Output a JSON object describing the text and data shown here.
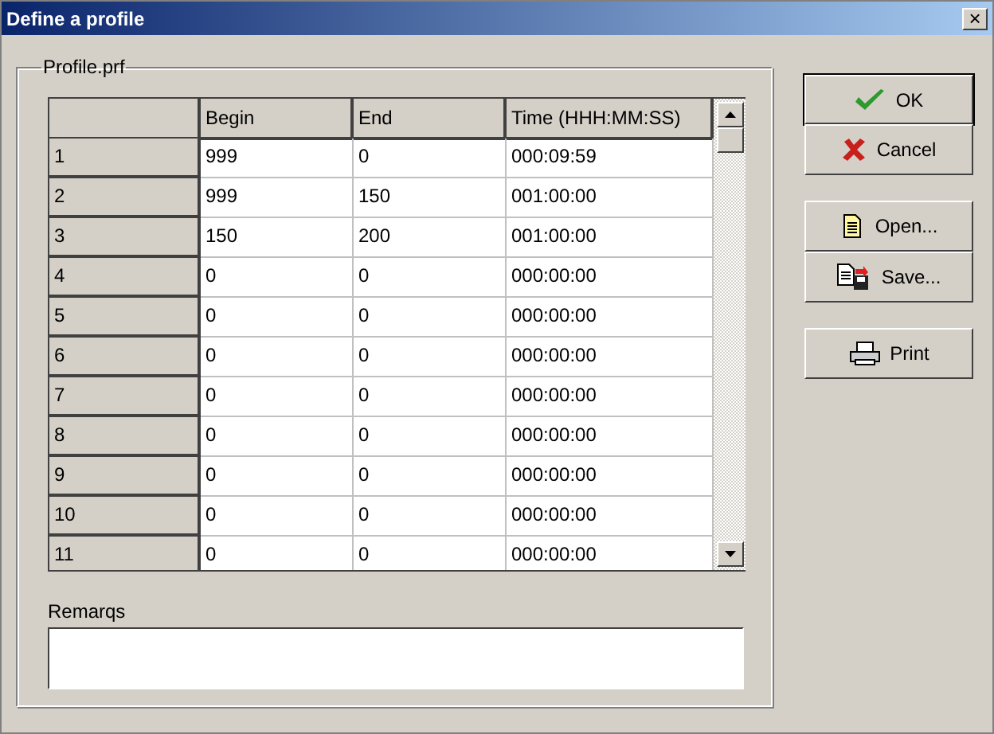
{
  "window": {
    "title": "Define a profile",
    "close": "×"
  },
  "group": {
    "title": "Profile.prf"
  },
  "table": {
    "columns": [
      "Begin",
      "End",
      "Time (HHH:MM:SS)"
    ],
    "rows": [
      {
        "label": "1",
        "cells": [
          "999",
          "0",
          "000:09:59"
        ]
      },
      {
        "label": "2",
        "cells": [
          "999",
          "150",
          "001:00:00"
        ]
      },
      {
        "label": "3",
        "cells": [
          "150",
          "200",
          "001:00:00"
        ]
      },
      {
        "label": "4",
        "cells": [
          "0",
          "0",
          "000:00:00"
        ]
      },
      {
        "label": "5",
        "cells": [
          "0",
          "0",
          "000:00:00"
        ]
      },
      {
        "label": "6",
        "cells": [
          "0",
          "0",
          "000:00:00"
        ]
      },
      {
        "label": "7",
        "cells": [
          "0",
          "0",
          "000:00:00"
        ]
      },
      {
        "label": "8",
        "cells": [
          "0",
          "0",
          "000:00:00"
        ]
      },
      {
        "label": "9",
        "cells": [
          "0",
          "0",
          "000:00:00"
        ]
      },
      {
        "label": "10",
        "cells": [
          "0",
          "0",
          "000:00:00"
        ]
      },
      {
        "label": "11",
        "cells": [
          "0",
          "0",
          "000:00:00"
        ]
      }
    ]
  },
  "remarks": {
    "label": "Remarqs"
  },
  "buttons": [
    {
      "label": "OK",
      "kind": "ok",
      "default": true
    },
    {
      "label": "Cancel",
      "kind": "cancel",
      "default": false
    },
    {
      "label": "Open...",
      "kind": "open",
      "default": false
    },
    {
      "label": "Save...",
      "kind": "save",
      "default": false
    },
    {
      "label": "Print",
      "kind": "print",
      "default": false
    }
  ]
}
